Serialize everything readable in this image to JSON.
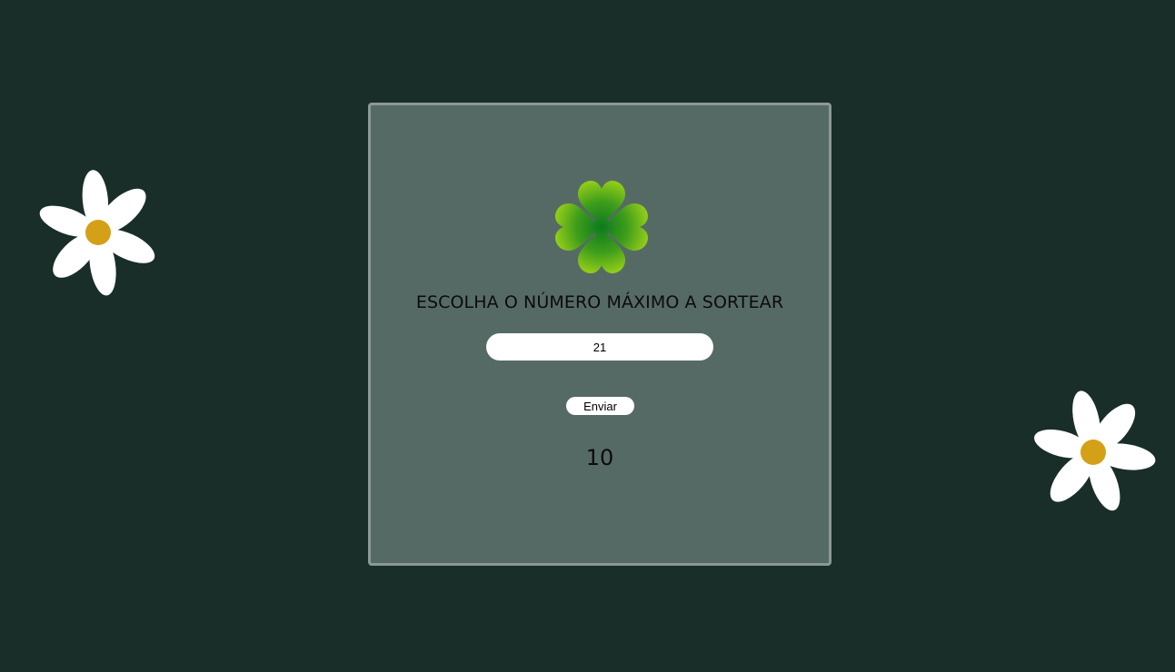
{
  "background_color": "#192e29",
  "card": {
    "title": "ESCOLHA O NÚMERO MÁXIMO A SORTEAR",
    "input_value": "21",
    "button_label": "Enviar",
    "result": "10",
    "background_color": "#566a65",
    "border_color": "#8b9995"
  },
  "decorations": {
    "logo_icon": "four-leaf-clover",
    "flower_icon": "daisy",
    "flower_petal_color": "#ffffff",
    "flower_center_color": "#d4a017",
    "clover_colors": [
      "#8fcb1a",
      "#0b7a1e"
    ]
  }
}
